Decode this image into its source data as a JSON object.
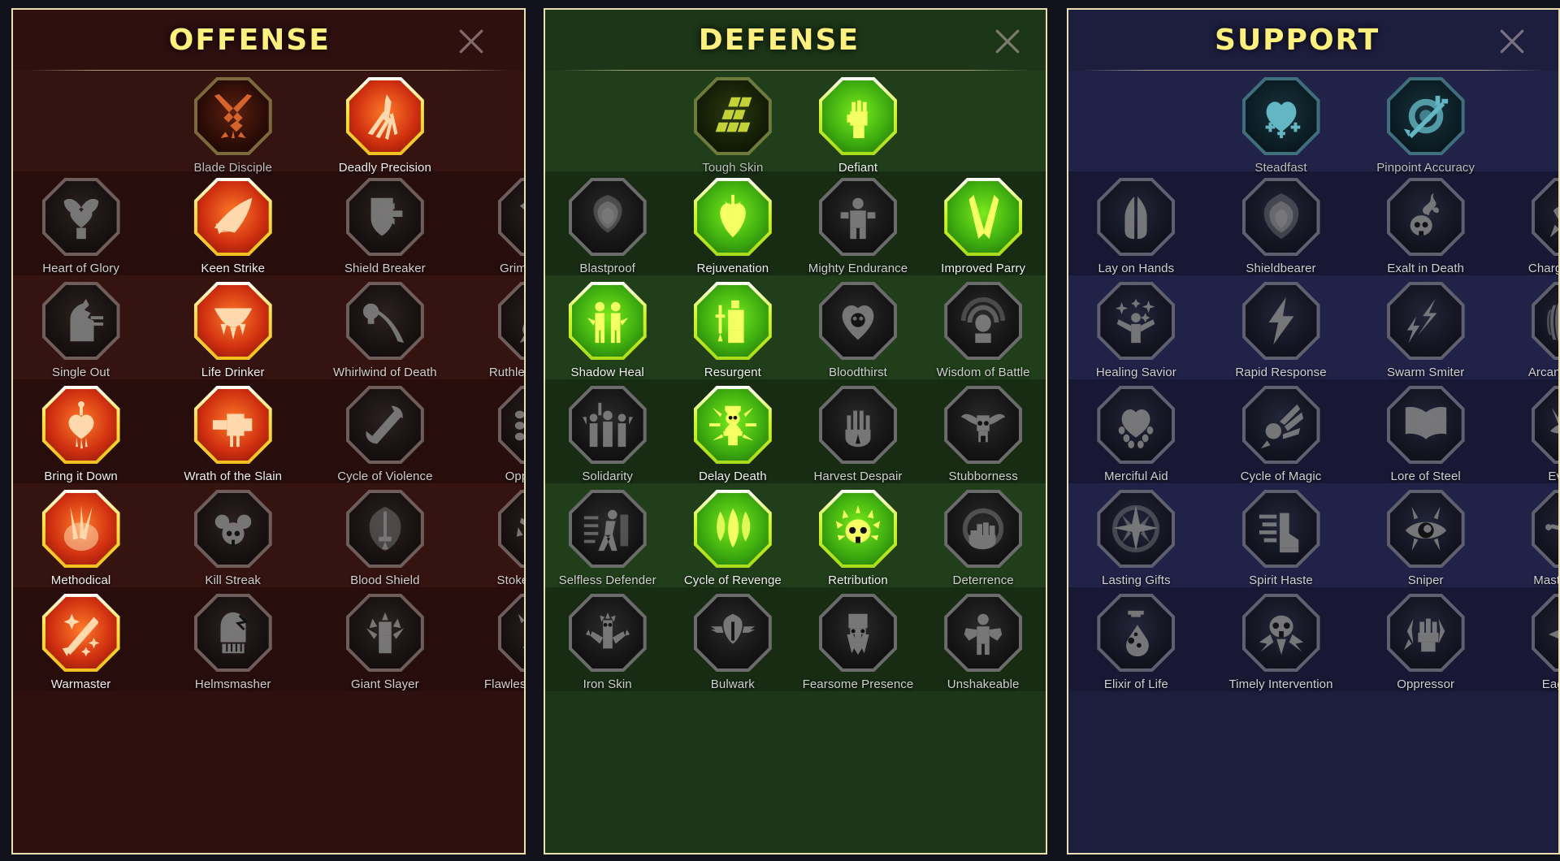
{
  "close_icon": "close-icon",
  "panels": [
    {
      "id": "offense",
      "title": "OFFENSE",
      "accent": "#ff7a28",
      "title_color": "#fdf07e",
      "border_color": "#e8e0b0",
      "background": "#2e100f",
      "rows": [
        {
          "type": "cap",
          "nodes": [
            {
              "label": "Blade Disciple",
              "state": "tinted",
              "icon": "crossed-swords-icon"
            },
            {
              "label": "Deadly Precision",
              "state": "active",
              "icon": "dagger-burst-icon"
            }
          ]
        },
        {
          "type": "grid",
          "nodes": [
            {
              "label": "Heart of Glory",
              "state": "locked",
              "icon": "winged-heart-icon"
            },
            {
              "label": "Keen Strike",
              "state": "active",
              "icon": "slash-streak-icon"
            },
            {
              "label": "Shield Breaker",
              "state": "locked",
              "icon": "broken-shield-icon"
            },
            {
              "label": "Grim Resolve",
              "state": "locked",
              "icon": "pierced-heart-icon"
            }
          ]
        },
        {
          "type": "grid",
          "nodes": [
            {
              "label": "Single Out",
              "state": "locked",
              "icon": "chess-knight-icon"
            },
            {
              "label": "Life Drinker",
              "state": "active",
              "icon": "fanged-maw-icon"
            },
            {
              "label": "Whirlwind of Death",
              "state": "locked",
              "icon": "skull-scythe-icon"
            },
            {
              "label": "Ruthless Ambush",
              "state": "locked",
              "icon": "dagger-hand-icon"
            }
          ]
        },
        {
          "type": "grid",
          "nodes": [
            {
              "label": "Bring it Down",
              "state": "active",
              "icon": "sword-heart-icon"
            },
            {
              "label": "Wrath of the Slain",
              "state": "active",
              "icon": "skeleton-fist-icon"
            },
            {
              "label": "Cycle of Violence",
              "state": "locked",
              "icon": "axe-cycle-icon"
            },
            {
              "label": "Opportunist",
              "state": "locked",
              "icon": "chain-lightning-icon"
            }
          ]
        },
        {
          "type": "grid",
          "nodes": [
            {
              "label": "Methodical",
              "state": "active",
              "icon": "arrows-target-icon"
            },
            {
              "label": "Kill Streak",
              "state": "locked",
              "icon": "triple-skull-icon"
            },
            {
              "label": "Blood Shield",
              "state": "locked",
              "icon": "sword-shield-icon"
            },
            {
              "label": "Stoked to Fury",
              "state": "locked",
              "icon": "raging-figure-icon"
            }
          ]
        },
        {
          "type": "grid",
          "nodes": [
            {
              "label": "Warmaster",
              "state": "active",
              "icon": "sparkle-blades-icon"
            },
            {
              "label": "Helmsmasher",
              "state": "locked",
              "icon": "cracked-helm-icon"
            },
            {
              "label": "Giant Slayer",
              "state": "locked",
              "icon": "giant-beast-icon"
            },
            {
              "label": "Flawless Execution",
              "state": "locked",
              "icon": "horned-skull-icon"
            }
          ]
        }
      ]
    },
    {
      "id": "defense",
      "title": "DEFENSE",
      "accent": "#7bea1c",
      "title_color": "#fdf07e",
      "border_color": "#e8e0b0",
      "background": "#1c3617",
      "rows": [
        {
          "type": "cap",
          "nodes": [
            {
              "label": "Tough Skin",
              "state": "tinted",
              "icon": "scale-plates-icon"
            },
            {
              "label": "Defiant",
              "state": "active",
              "icon": "raised-fist-icon"
            }
          ]
        },
        {
          "type": "grid",
          "nodes": [
            {
              "label": "Blastproof",
              "state": "locked",
              "icon": "layered-shield-icon"
            },
            {
              "label": "Rejuvenation",
              "state": "active",
              "icon": "heart-organ-icon"
            },
            {
              "label": "Mighty Endurance",
              "state": "locked",
              "icon": "stone-body-icon"
            },
            {
              "label": "Improved Parry",
              "state": "active",
              "icon": "crossed-blades-icon"
            }
          ]
        },
        {
          "type": "grid",
          "nodes": [
            {
              "label": "Shadow Heal",
              "state": "active",
              "icon": "two-figures-icon"
            },
            {
              "label": "Resurgent",
              "state": "active",
              "icon": "knight-sword-icon"
            },
            {
              "label": "Bloodthirst",
              "state": "locked",
              "icon": "skull-heart-icon"
            },
            {
              "label": "Wisdom of Battle",
              "state": "locked",
              "icon": "aura-head-icon"
            }
          ]
        },
        {
          "type": "grid",
          "nodes": [
            {
              "label": "Solidarity",
              "state": "locked",
              "icon": "crowd-icon"
            },
            {
              "label": "Delay Death",
              "state": "active",
              "icon": "hourglass-skull-icon"
            },
            {
              "label": "Harvest Despair",
              "state": "locked",
              "icon": "open-hand-icon"
            },
            {
              "label": "Stubborness",
              "state": "locked",
              "icon": "bull-skull-icon"
            }
          ]
        },
        {
          "type": "grid",
          "nodes": [
            {
              "label": "Selfless Defender",
              "state": "locked",
              "icon": "running-guard-icon"
            },
            {
              "label": "Cycle of Revenge",
              "state": "active",
              "icon": "flame-drops-icon"
            },
            {
              "label": "Retribution",
              "state": "active",
              "icon": "crowned-skull-icon"
            },
            {
              "label": "Deterrence",
              "state": "locked",
              "icon": "warding-hand-icon"
            }
          ]
        },
        {
          "type": "grid",
          "nodes": [
            {
              "label": "Iron Skin",
              "state": "locked",
              "icon": "spiked-figure-icon"
            },
            {
              "label": "Bulwark",
              "state": "locked",
              "icon": "winged-shield-icon"
            },
            {
              "label": "Fearsome Presence",
              "state": "locked",
              "icon": "bearded-face-icon"
            },
            {
              "label": "Unshakeable",
              "state": "locked",
              "icon": "braced-figure-icon"
            }
          ]
        }
      ]
    },
    {
      "id": "support",
      "title": "SUPPORT",
      "accent": "#63b6c4",
      "title_color": "#fdf07e",
      "border_color": "#e8e0b0",
      "background": "#1d1d3e",
      "rows": [
        {
          "type": "cap",
          "nodes": [
            {
              "label": "Steadfast",
              "state": "tinted",
              "icon": "heart-plus-icon"
            },
            {
              "label": "Pinpoint Accuracy",
              "state": "tinted",
              "icon": "target-arrow-icon"
            }
          ]
        },
        {
          "type": "grid",
          "nodes": [
            {
              "label": "Lay on Hands",
              "state": "locked",
              "icon": "praying-hands-icon"
            },
            {
              "label": "Shieldbearer",
              "state": "locked",
              "icon": "shield-aura-icon"
            },
            {
              "label": "Exalt in Death",
              "state": "locked",
              "icon": "smoke-skull-icon"
            },
            {
              "label": "Charged Focus",
              "state": "locked",
              "icon": "beam-hand-icon"
            }
          ]
        },
        {
          "type": "grid",
          "nodes": [
            {
              "label": "Healing Savior",
              "state": "locked",
              "icon": "sparkle-figure-icon"
            },
            {
              "label": "Rapid Response",
              "state": "locked",
              "icon": "lightning-bolt-icon"
            },
            {
              "label": "Swarm Smiter",
              "state": "locked",
              "icon": "jagged-bolts-icon"
            },
            {
              "label": "Arcane Celerity",
              "state": "locked",
              "icon": "speed-figure-icon"
            }
          ]
        },
        {
          "type": "grid",
          "nodes": [
            {
              "label": "Merciful Aid",
              "state": "locked",
              "icon": "chained-heart-icon"
            },
            {
              "label": "Cycle of Magic",
              "state": "locked",
              "icon": "comet-icon"
            },
            {
              "label": "Lore of Steel",
              "state": "locked",
              "icon": "open-book-icon"
            },
            {
              "label": "Evil Eye",
              "state": "locked",
              "icon": "glaring-eyes-icon"
            }
          ]
        },
        {
          "type": "grid",
          "nodes": [
            {
              "label": "Lasting Gifts",
              "state": "locked",
              "icon": "compass-star-icon"
            },
            {
              "label": "Spirit Haste",
              "state": "locked",
              "icon": "swift-boot-icon"
            },
            {
              "label": "Sniper",
              "state": "locked",
              "icon": "eye-arrows-icon"
            },
            {
              "label": "Master Hexer",
              "state": "locked",
              "icon": "voodoo-doll-icon"
            }
          ]
        },
        {
          "type": "grid",
          "nodes": [
            {
              "label": "Elixir of Life",
              "state": "locked",
              "icon": "potion-flask-icon"
            },
            {
              "label": "Timely Intervention",
              "state": "locked",
              "icon": "winged-skull-icon"
            },
            {
              "label": "Oppressor",
              "state": "locked",
              "icon": "crushing-fist-icon"
            },
            {
              "label": "Eagle-Eye",
              "state": "locked",
              "icon": "eagle-head-icon"
            }
          ]
        }
      ]
    }
  ]
}
